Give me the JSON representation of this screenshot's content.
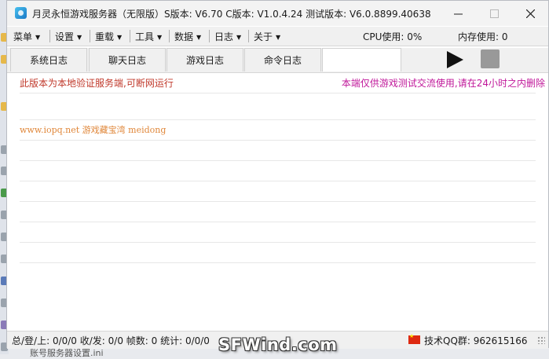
{
  "window": {
    "title": "月灵永恒游戏服务器（无限版）S版本: V6.70 C版本: V1.0.4.24 测试版本: V6.0.8899.40638"
  },
  "menu": {
    "items": [
      {
        "label": "菜单"
      },
      {
        "label": "设置"
      },
      {
        "label": "重载"
      },
      {
        "label": "工具"
      },
      {
        "label": "数据"
      },
      {
        "label": "日志"
      },
      {
        "label": "关于"
      }
    ],
    "cpu_usage": "CPU使用: 0%",
    "mem_usage": "内存使用: 0"
  },
  "tabs": [
    {
      "label": "系统日志"
    },
    {
      "label": "聊天日志"
    },
    {
      "label": "游戏日志"
    },
    {
      "label": "命令日志"
    }
  ],
  "log": {
    "line1_left": "此版本为本地验证服务端,可断网运行",
    "line1_right": "本端仅供游戏测试交流使用,请在24小时之内删除",
    "line2": "www.iopq.net 游戏藏宝湾 meidong"
  },
  "status": {
    "left": "总/登/上: 0/0/0  收/发: 0/0  帧数: 0  统计: 0/0/0",
    "qq": "技术QQ群:  962615166"
  },
  "background": {
    "file_name": "账号服务器设置.ini",
    "watermark": "SFWind.com"
  },
  "colors": {
    "log_red": "#c0392b",
    "log_magenta": "#c0189a",
    "log_orange": "#e0873a"
  }
}
